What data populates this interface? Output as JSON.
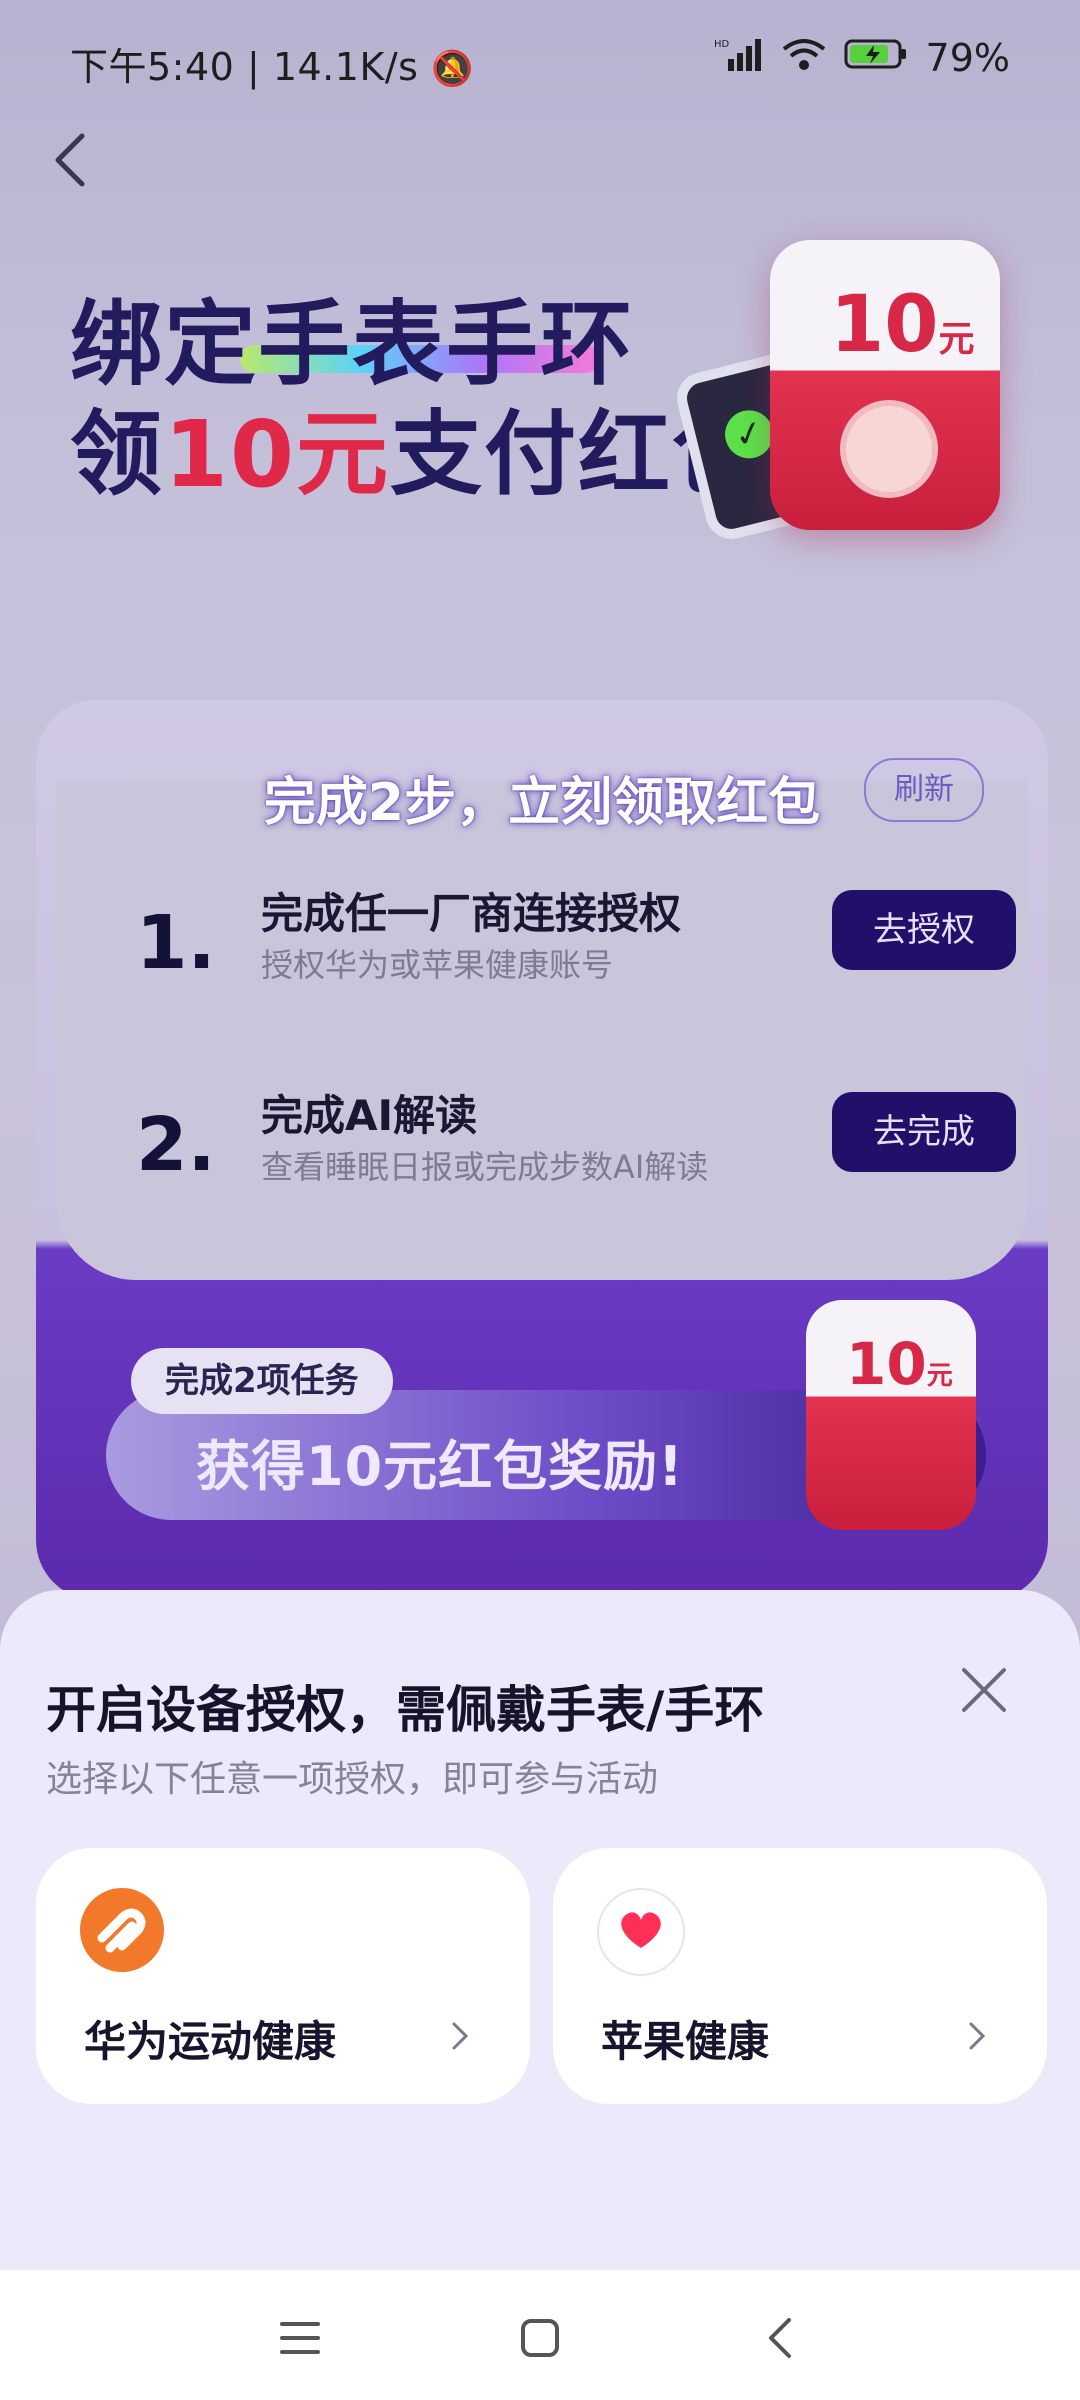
{
  "status": {
    "time": "下午5:40",
    "speed": "14.1K/s",
    "network": "HD",
    "battery": "79%"
  },
  "banner": {
    "line1": "绑定手表手环",
    "line2_prefix": "领",
    "line2_amount": "10元",
    "line2_suffix": "支付红包",
    "packet_amount": "10",
    "packet_unit": "元"
  },
  "tasks": {
    "title": "完成2步，立刻领取红包",
    "refresh_label": "刷新",
    "steps": [
      {
        "num": "1.",
        "title": "完成任一厂商连接授权",
        "subtitle": "授权华为或苹果健康账号",
        "button": "去授权"
      },
      {
        "num": "2.",
        "title": "完成AI解读",
        "subtitle": "查看睡眠日报或完成步数AI解读",
        "button": "去完成"
      }
    ],
    "reward_tag": "完成2项任务",
    "reward_text": "获得10元红包奖励!",
    "packet_amount": "10",
    "packet_unit": "元"
  },
  "sheet": {
    "title": "开启设备授权，需佩戴手表/手环",
    "subtitle": "选择以下任意一项授权，即可参与活动",
    "options": [
      {
        "label": "华为运动健康",
        "icon": "huawei-health-icon"
      },
      {
        "label": "苹果健康",
        "icon": "apple-health-icon"
      }
    ]
  },
  "colors": {
    "accent": "#220f6a",
    "red": "#e02848",
    "sheet_bg": "#ece9fa"
  }
}
